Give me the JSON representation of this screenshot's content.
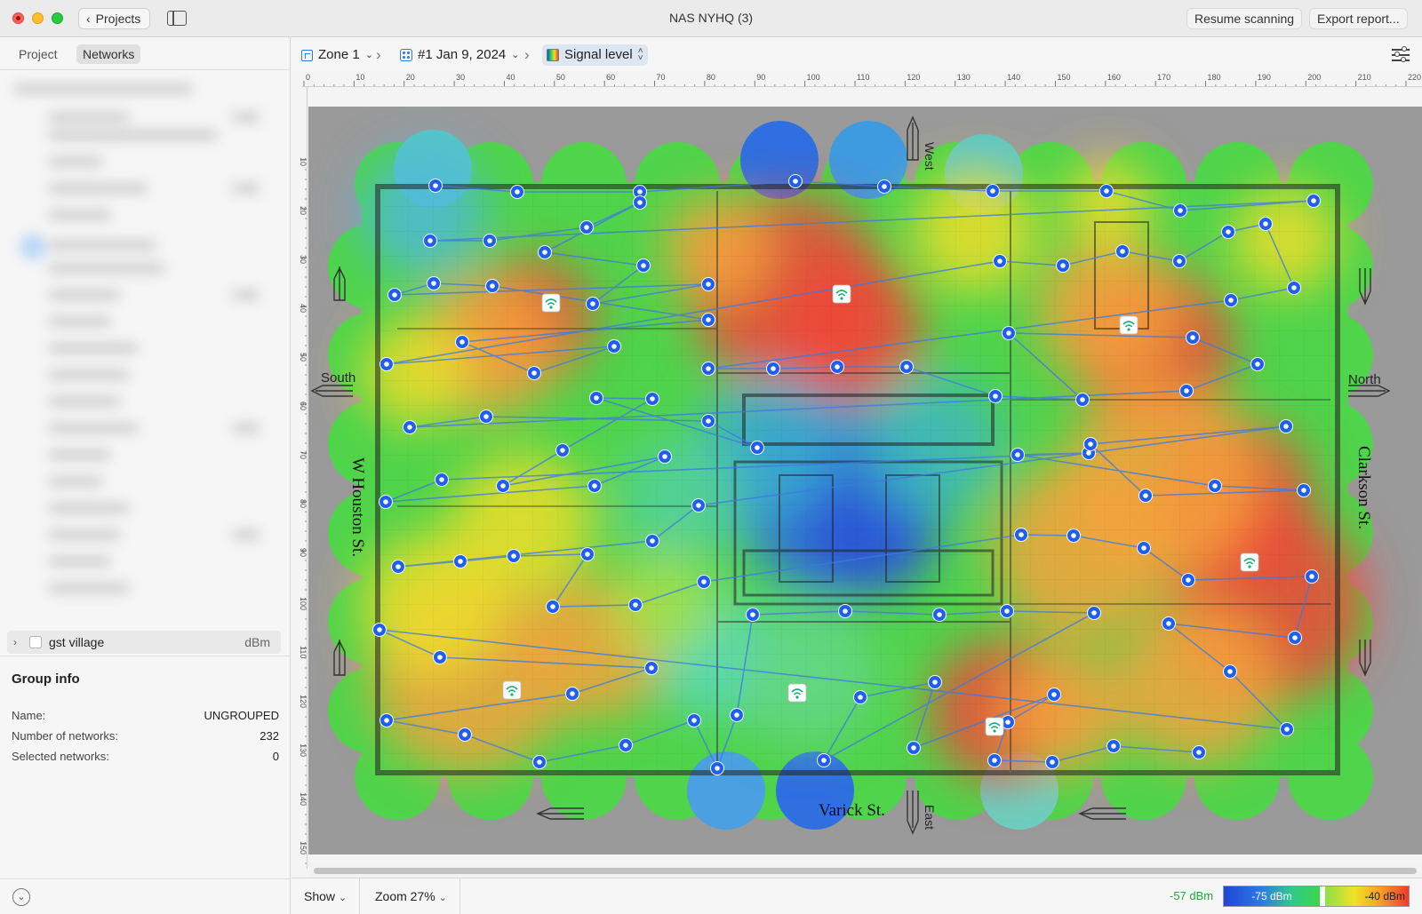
{
  "window": {
    "title": "NAS NYHQ (3)",
    "back_label": "Projects",
    "resume_label": "Resume scanning",
    "export_label": "Export report..."
  },
  "sidebar": {
    "tab_project": "Project",
    "tab_networks": "Networks",
    "group_row": {
      "name": "gst village",
      "unit": "dBm"
    },
    "group_info": {
      "title": "Group info",
      "rows": [
        {
          "label": "Name:",
          "value": "UNGROUPED"
        },
        {
          "label": "Number of networks:",
          "value": "232"
        },
        {
          "label": "Selected networks:",
          "value": "0"
        }
      ]
    }
  },
  "toolbar": {
    "zone": "Zone 1",
    "survey": "#1 Jan 9, 2024",
    "visualization": "Signal level"
  },
  "ruler": {
    "top_ticks": [
      "0",
      "10",
      "20",
      "30",
      "40",
      "50",
      "60",
      "70",
      "80",
      "90",
      "100",
      "110",
      "120",
      "130",
      "140",
      "150",
      "160",
      "170",
      "180",
      "190",
      "200",
      "210",
      "220"
    ],
    "left_ticks": [
      "10",
      "20",
      "30",
      "40",
      "50",
      "60",
      "70",
      "80",
      "90",
      "100",
      "110",
      "120",
      "130",
      "140",
      "150"
    ]
  },
  "map": {
    "labels": {
      "west": "West",
      "east": "East",
      "south": "South",
      "north": "North",
      "street_left": "W Houston St.",
      "street_right": "Clarkson St.",
      "street_bottom": "Varick St."
    }
  },
  "bottombar": {
    "show_label": "Show",
    "zoom_label": "Zoom 27%",
    "legend_current": "-57 dBm",
    "legend_min": "-75 dBm",
    "legend_max": "-40 dBm"
  },
  "colors": {
    "accent": "#2a7de1",
    "heat_red": "#f1473a",
    "heat_orange": "#f6a23c",
    "heat_yellow": "#eedd2c",
    "heat_green": "#4fd44b",
    "heat_blue": "#2f6fe0",
    "legend_green_text": "#2fa13a"
  }
}
